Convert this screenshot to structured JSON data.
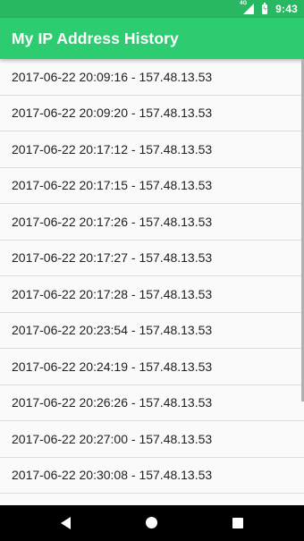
{
  "status_bar": {
    "network_label": "4G",
    "time": "9:43",
    "icons": [
      "signal-icon",
      "battery-icon"
    ]
  },
  "app_bar": {
    "title": "My IP Address History",
    "background_color": "#2ecc71"
  },
  "history": {
    "items": [
      "2017-06-22 20:09:16 - 157.48.13.53",
      "2017-06-22 20:09:20 - 157.48.13.53",
      "2017-06-22 20:17:12 - 157.48.13.53",
      "2017-06-22 20:17:15 - 157.48.13.53",
      "2017-06-22 20:17:26 - 157.48.13.53",
      "2017-06-22 20:17:27 - 157.48.13.53",
      "2017-06-22 20:17:28 - 157.48.13.53",
      "2017-06-22 20:23:54 - 157.48.13.53",
      "2017-06-22 20:24:19 - 157.48.13.53",
      "2017-06-22 20:26:26 - 157.48.13.53",
      "2017-06-22 20:27:00 - 157.48.13.53",
      "2017-06-22 20:30:08 - 157.48.13.53"
    ]
  },
  "nav_bar": {
    "icons": [
      "back-icon",
      "home-icon",
      "recents-icon"
    ]
  }
}
